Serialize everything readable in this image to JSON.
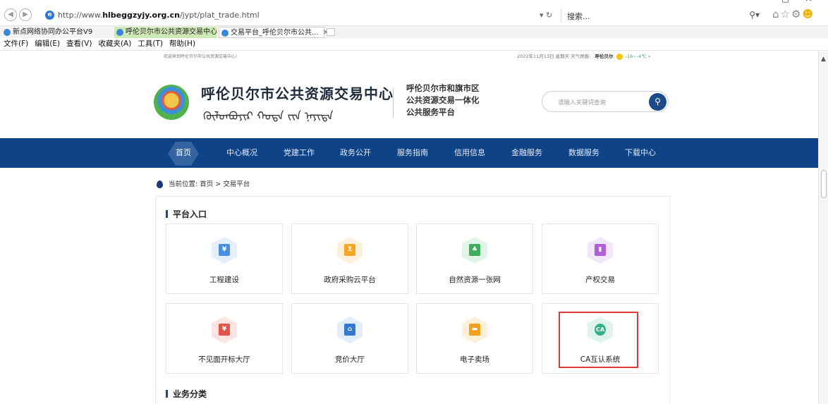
{
  "browser": {
    "url_prefix": "http://www.",
    "url_domain": "hlbeggzyjy.org.cn",
    "url_path": "/jypt/plat_trade.html",
    "search_placeholder": "搜索...",
    "tabs": [
      {
        "label": "新点网络协同办公平台V9",
        "state": "normal"
      },
      {
        "label": "呼伦贝尔市公共资源交易中心",
        "state": "green"
      },
      {
        "label": "交易平台_呼伦贝尔市公共...",
        "state": "active"
      }
    ],
    "menu": [
      "文件(F)",
      "编辑(E)",
      "查看(V)",
      "收藏夹(A)",
      "工具(T)",
      "帮助(H)"
    ]
  },
  "topbar": {
    "welcome": "欢迎来到呼伦贝尔市公共资源交易中心!",
    "date": "2022年11月13日 星期天",
    "weather_label": "天气预报:",
    "city": "呼伦贝尔",
    "temperature": "-16~-4℃",
    "more": "»"
  },
  "header": {
    "title": "呼伦贝尔市公共资源交易中心",
    "mongolian": "ᠬᠥᠯᠥᠨᠪᠤᠶᠢᠷ ᠬᠣᠲᠠ ᠵᠢᠨ ᠨᠡᠶᠢᠲᠡ",
    "subtitle_line1": "呼伦贝尔市和旗市区",
    "subtitle_line2": "公共资源交易一体化",
    "subtitle_line3": "公共服务平台",
    "search_placeholder": "请输入关键词查询"
  },
  "nav": {
    "items": [
      "首页",
      "中心概况",
      "党建工作",
      "政务公开",
      "服务指南",
      "信用信息",
      "金融服务",
      "数据服务",
      "下载中心"
    ]
  },
  "breadcrumb": {
    "label": "当前位置:",
    "path": "首页 > 交易平台"
  },
  "sections": {
    "platform_title": "平台入口",
    "business_title": "业务分类"
  },
  "cards": [
    {
      "label": "工程建设",
      "icon": "building-doc-icon",
      "color": "#4a90e2",
      "bg": "#e4effb",
      "glyph": "¥"
    },
    {
      "label": "政府采购云平台",
      "icon": "shopping-cart-icon",
      "color": "#f5a623",
      "bg": "#fdf1dc",
      "glyph": "🛒"
    },
    {
      "label": "自然资源一张网",
      "icon": "trees-icon",
      "color": "#3fae5b",
      "bg": "#e1f4e5",
      "glyph": "♣"
    },
    {
      "label": "产权交易",
      "icon": "book-icon",
      "color": "#b05ed9",
      "bg": "#f2e6f9",
      "glyph": "▮"
    },
    {
      "label": "不见面开标大厅",
      "icon": "remote-bid-icon",
      "color": "#e3534b",
      "bg": "#fbe4e2",
      "glyph": "¥"
    },
    {
      "label": "竞价大厅",
      "icon": "bank-icon",
      "color": "#3478d0",
      "bg": "#e3eefb",
      "glyph": "⌂"
    },
    {
      "label": "电子卖场",
      "icon": "store-icon",
      "color": "#f2a01e",
      "bg": "#fdf0d9",
      "glyph": "▬"
    },
    {
      "label": "CA互认系统",
      "icon": "ca-badge-icon",
      "color": "#35b08a",
      "bg": "#dff4ec",
      "glyph": "CA"
    }
  ]
}
